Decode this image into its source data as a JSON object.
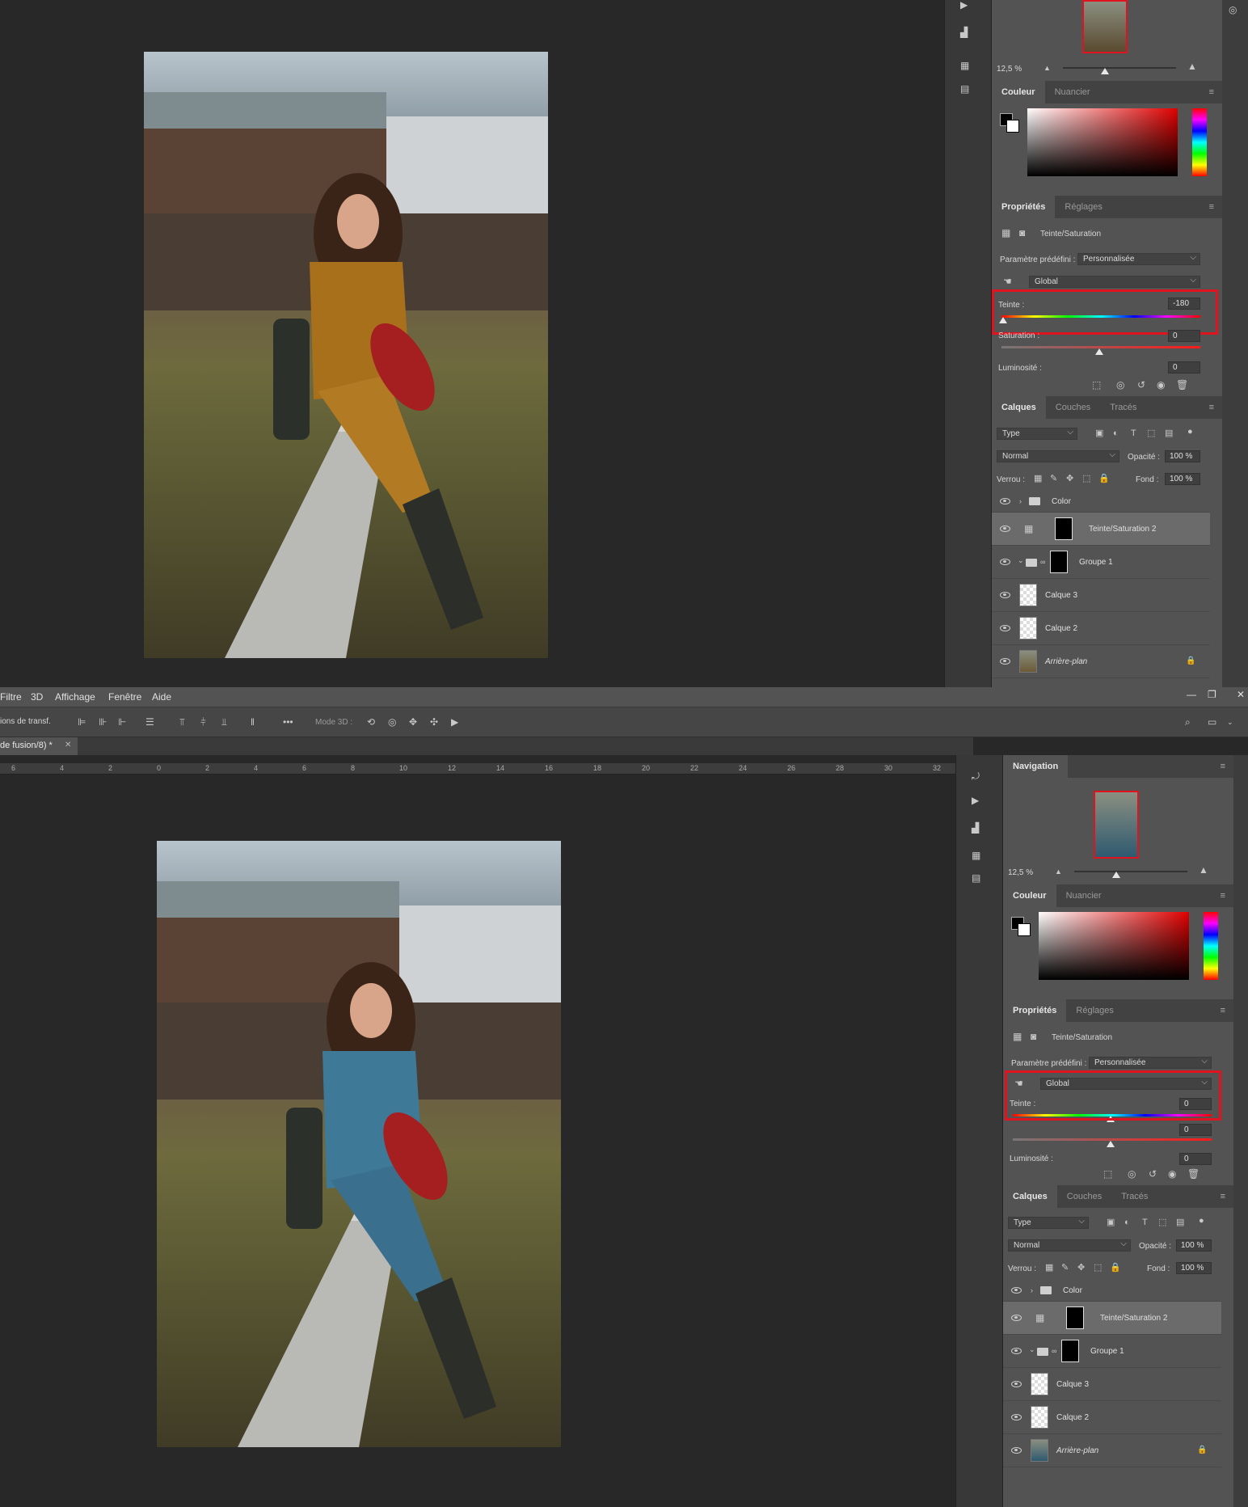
{
  "colors": {
    "accent_red": "#e0141e",
    "panel_bg": "#535353",
    "workspace_bg": "#282828"
  },
  "before": {
    "navigator": {
      "zoom": "12,5 %"
    },
    "color_panel": {
      "tabs": [
        "Couleur",
        "Nuancier"
      ]
    },
    "properties": {
      "tabs": [
        "Propriétés",
        "Réglages"
      ],
      "adjustment_name": "Teinte/Saturation",
      "preset_label": "Paramètre prédéfini :",
      "preset_value": "Personnalisée",
      "channel": "Global",
      "hue_label": "Teinte :",
      "hue_value": "-180",
      "saturation_label": "Saturation :",
      "saturation_value": "0",
      "lightness_label": "Luminosité :",
      "lightness_value": "0"
    },
    "layers_panel": {
      "tabs": [
        "Calques",
        "Couches",
        "Tracés"
      ],
      "filter": "Type",
      "blend_mode": "Normal",
      "opacity_label": "Opacité :",
      "opacity_value": "100 %",
      "lock_label": "Verrou :",
      "fill_label": "Fond :",
      "fill_value": "100 %",
      "layers": [
        "Color",
        "Teinte/Saturation 2",
        "Groupe 1",
        "Calque 3",
        "Calque 2",
        "Arrière-plan"
      ]
    }
  },
  "after": {
    "menu": [
      "Filtre",
      "3D",
      "Affichage",
      "Fenêtre",
      "Aide"
    ],
    "options": {
      "transform_label": "ions de transf.",
      "mode3d_label": "Mode 3D :"
    },
    "document_tab": "de fusion/8) *",
    "ruler_ticks": [
      "6",
      "4",
      "2",
      "0",
      "2",
      "4",
      "6",
      "8",
      "10",
      "12",
      "14",
      "16",
      "18",
      "20",
      "22",
      "24",
      "26",
      "28",
      "30",
      "32"
    ],
    "navigator": {
      "title": "Navigation",
      "zoom": "12,5 %"
    },
    "color_panel": {
      "tabs": [
        "Couleur",
        "Nuancier"
      ]
    },
    "properties": {
      "tabs": [
        "Propriétés",
        "Réglages"
      ],
      "adjustment_name": "Teinte/Saturation",
      "preset_label": "Paramètre prédéfini :",
      "preset_value": "Personnalisée",
      "channel": "Global",
      "hue_label": "Teinte :",
      "hue_value": "0",
      "saturation_value": "0",
      "lightness_label": "Luminosité :",
      "lightness_value": "0"
    },
    "layers_panel": {
      "tabs": [
        "Calques",
        "Couches",
        "Tracés"
      ],
      "filter": "Type",
      "blend_mode": "Normal",
      "opacity_label": "Opacité :",
      "opacity_value": "100 %",
      "lock_label": "Verrou :",
      "fill_label": "Fond :",
      "fill_value": "100 %",
      "layers": [
        "Color",
        "Teinte/Saturation 2",
        "Groupe 1",
        "Calque 3",
        "Calque 2",
        "Arrière-plan"
      ]
    }
  }
}
